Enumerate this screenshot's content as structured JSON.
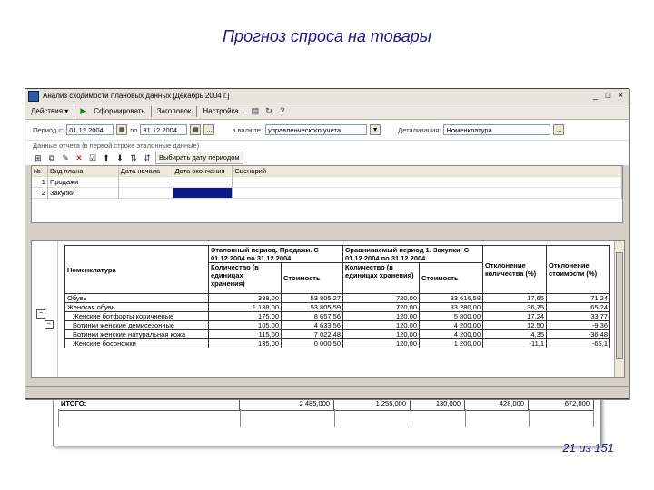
{
  "slide": {
    "title": "Прогноз спроса на товары",
    "page_number": "21 из 151"
  },
  "window": {
    "title": "Анализ сходимости плановых данных [Декабрь 2004 г.]",
    "controls": [
      "_",
      "□",
      "×"
    ]
  },
  "toolbar": {
    "actions_label": "Действия ▾",
    "generate_label": "Сформировать",
    "header_label": "Заголовок",
    "settings_label": "Настройка..."
  },
  "params": {
    "period_from_label": "Период с:",
    "period_from_value": "01.12.2004",
    "period_to_label": "по",
    "period_to_value": "31.12.2004",
    "currency_label": "в валюте:",
    "currency_value": "управленческого учета",
    "detail_label": "Детализация:",
    "detail_value": "Номенклатура"
  },
  "section_label": "Данные отчета (в первой строке эталонные данные)",
  "data_toolbar": {
    "select_period_label": "Выбирать дату периодом"
  },
  "grid1": {
    "columns": [
      "№",
      "Вид плана",
      "Дата начала",
      "Дата окончания",
      "Сценарий"
    ],
    "rows": [
      [
        "1",
        "Продажи",
        "",
        "",
        ""
      ],
      [
        "2",
        "Закупки",
        "",
        "",
        ""
      ]
    ]
  },
  "report": {
    "nomenclature_header": "Номенклатура",
    "ref_period_header": "Эталонный период. Продажи. С 01.12.2004 по 31.12.2004",
    "cmp_period_header": "Сравниваемый период 1. Закупки. С 01.12.2004 по 31.12.2004",
    "qty_header": "Количество (в единицах хранения)",
    "cost_header": "Стоимость",
    "qty_dev_header": "Отклонение количества (%)",
    "cost_dev_header": "Отклонение стоимости (%)",
    "rows": [
      [
        "Обувь",
        "388,00",
        "53 805,27",
        "720,00",
        "33 616,58",
        "17,65",
        "71,24"
      ],
      [
        "Женская обувь",
        "1 138,00",
        "53 805,59",
        "720,00",
        "33 280,00",
        "36,75",
        "65,24"
      ],
      [
        "Женские ботфорты коричневые",
        "175,00",
        "8 657,56",
        "120,00",
        "5 800,00",
        "17,24",
        "33,77"
      ],
      [
        "Ботинки женские демисезонные",
        "105,00",
        "4 633,56",
        "120,00",
        "4 200,00",
        "12,50",
        "-9,36"
      ],
      [
        "Ботинки женские натуральная кожа",
        "115,00",
        "7 022,48",
        "120,00",
        "4 200,00",
        "4,35",
        "-36,48"
      ],
      [
        "Женские босоножки",
        "135,00",
        "0 000,50",
        "120,00",
        "1 200,00",
        "-11,1",
        "-65,1"
      ]
    ],
    "total_label": "ИТОГО:",
    "total_values": [
      "2 485,000",
      "1 255,000",
      "130,000",
      "428,000",
      "672,000"
    ]
  }
}
